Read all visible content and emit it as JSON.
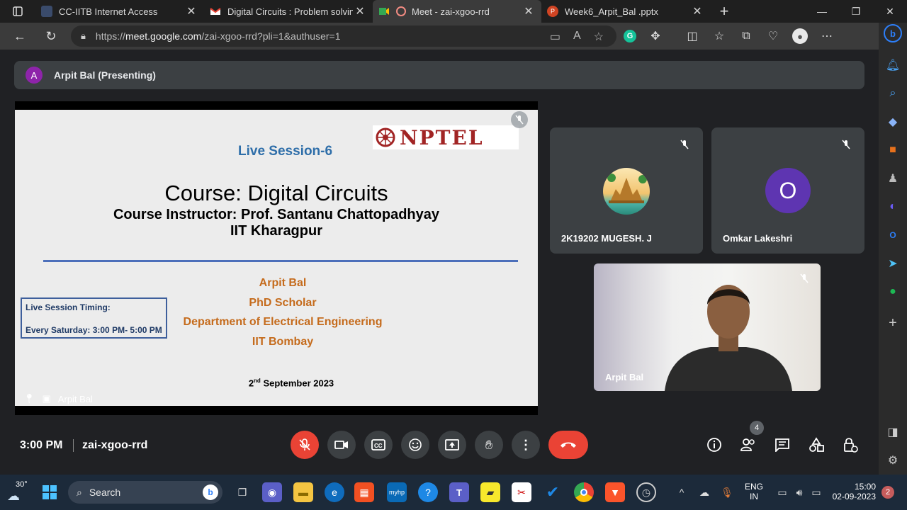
{
  "browser": {
    "tabs": [
      {
        "title": "CC-IITB Internet Access",
        "active": false
      },
      {
        "title": "Digital Circuits : Problem solving",
        "active": false
      },
      {
        "title": "Meet - zai-xgoo-rrd",
        "active": true
      },
      {
        "title": "Week6_Arpit_Bal .pptx",
        "active": false
      }
    ],
    "url_prefix": "https://",
    "url_host": "meet.google.com",
    "url_path": "/zai-xgoo-rrd?pli=1&authuser=1"
  },
  "meet": {
    "presenter_initial": "A",
    "presenter_label": "Arpit Bal (Presenting)",
    "slide": {
      "session": "Live Session-6",
      "logo_text": "NPTEL",
      "course": "Course: Digital Circuits",
      "instructor": "Course Instructor: Prof. Santanu Chattopadhyay",
      "institute": "IIT Kharagpur",
      "presenter_name": "Arpit Bal",
      "presenter_role": "PhD Scholar",
      "presenter_dept": "Department of Electrical Engineering",
      "presenter_inst": "IIT Bombay",
      "timing_label": "Live Session Timing:",
      "timing_value": "Every Saturday: 3:00 PM- 5:00 PM",
      "date_day": "2",
      "date_suffix": "nd",
      "date_rest": " September 2023",
      "overlay_name": "Arpit Bal"
    },
    "participants": [
      {
        "name": "2K19202 MUGESH. J"
      },
      {
        "name": "Omkar Lakeshri",
        "initial": "O"
      },
      {
        "name": "Arpit Bal"
      }
    ],
    "time": "3:00 PM",
    "meeting_code": "zai-xgoo-rrd",
    "people_count": "4"
  },
  "taskbar": {
    "weather": "30°",
    "search_label": "Search",
    "lang_line1": "ENG",
    "lang_line2": "IN",
    "clock_time": "15:00",
    "clock_date": "02-09-2023",
    "notif_count": "2"
  }
}
